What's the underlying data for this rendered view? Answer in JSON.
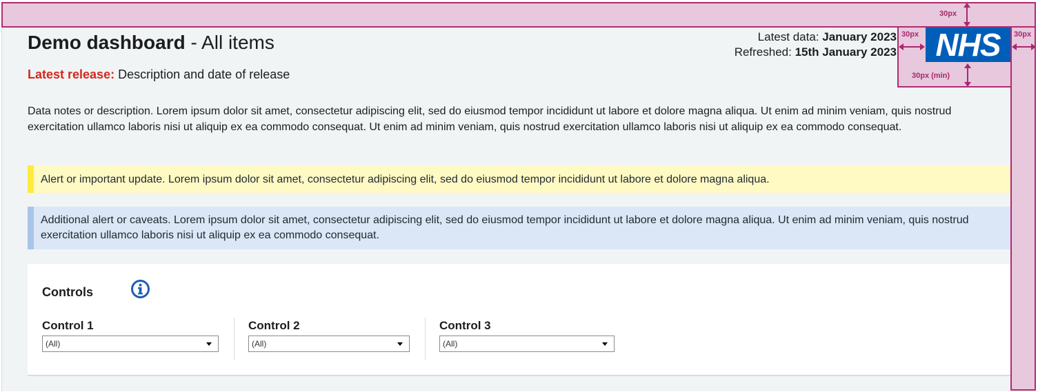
{
  "header": {
    "title_bold": "Demo dashboard",
    "title_rest": " - All items",
    "latest_data_label": "Latest data: ",
    "latest_data_value": "January 2023",
    "refreshed_label": "Refreshed: ",
    "refreshed_value": "15th January 2023",
    "logo_text": "NHS"
  },
  "release": {
    "label": "Latest release:",
    "text": " Description and date of release"
  },
  "notes": "Data notes or description. Lorem ipsum dolor sit amet, consectetur adipiscing elit, sed do eiusmod tempor incididunt ut labore et dolore magna aliqua. Ut enim ad minim veniam, quis nostrud exercitation ullamco laboris nisi ut aliquip ex ea commodo consequat. Ut enim ad minim veniam, quis nostrud exercitation ullamco laboris nisi ut aliquip ex ea commodo consequat.",
  "alerts": {
    "important": "Alert or important update. Lorem ipsum dolor sit amet, consectetur adipiscing elit, sed do eiusmod tempor incididunt ut labore et dolore magna aliqua.",
    "caveats": "Additional alert or caveats. Lorem ipsum dolor sit amet, consectetur adipiscing elit, sed do eiusmod tempor incididunt ut labore et dolore magna aliqua. Ut enim ad minim veniam, quis nostrud exercitation ullamco laboris nisi ut aliquip ex ea commodo consequat."
  },
  "controls": {
    "title": "Controls",
    "info_icon": "info-circle-icon",
    "items": [
      {
        "label": "Control 1",
        "value": "(All)"
      },
      {
        "label": "Control 2",
        "value": "(All)"
      },
      {
        "label": "Control 3",
        "value": "(All)"
      }
    ]
  },
  "annotations": {
    "top_margin": "30px",
    "logo_left_gap": "30px",
    "right_margin": "30px",
    "logo_below_gap": "30px (min)"
  },
  "colors": {
    "nhs_blue": "#005eb8",
    "release_red": "#d5281b",
    "alert_yellow_bg": "#fff9c4",
    "alert_yellow_bar": "#ffeb3b",
    "alert_blue_bg": "#dbe6f6",
    "alert_blue_bar": "#a9c5ea",
    "annotation_magenta": "#a8286e"
  }
}
